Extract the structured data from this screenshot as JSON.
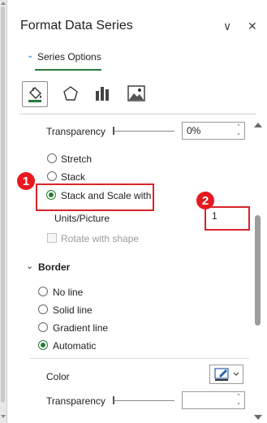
{
  "pane": {
    "title": "Format Data Series",
    "options_glyph": "∨",
    "close_glyph": "✕"
  },
  "tab": {
    "chevron": "⌄",
    "label": "Series Options"
  },
  "icons": [
    "fill-line-icon",
    "effects-icon",
    "series-options-icon",
    "picture-icon"
  ],
  "fill": {
    "transparency_label": "Transparency",
    "transparency_value": "0%",
    "transparency_fraction": 0.0,
    "options": [
      {
        "label": "Stretch",
        "checked": false
      },
      {
        "label": "Stack",
        "checked": false
      },
      {
        "label": "Stack and Scale with",
        "checked": true
      }
    ],
    "units_label": "Units/Picture",
    "units_value": "1",
    "rotate_label": "Rotate with shape",
    "rotate_checked": false
  },
  "border": {
    "section_label": "Border",
    "chevron": "⌄",
    "options": [
      {
        "label": "No line",
        "checked": false
      },
      {
        "label": "Solid line",
        "checked": false
      },
      {
        "label": "Gradient line",
        "checked": false
      },
      {
        "label": "Automatic",
        "checked": true
      }
    ],
    "color_label": "Color",
    "transparency_label": "Transparency",
    "transparency_value": ""
  },
  "callouts": {
    "first": "1",
    "second": "2"
  },
  "colors": {
    "accent_green": "#2b7a3b",
    "callout_red": "#d9232a",
    "badge_red": "#e7191f"
  }
}
